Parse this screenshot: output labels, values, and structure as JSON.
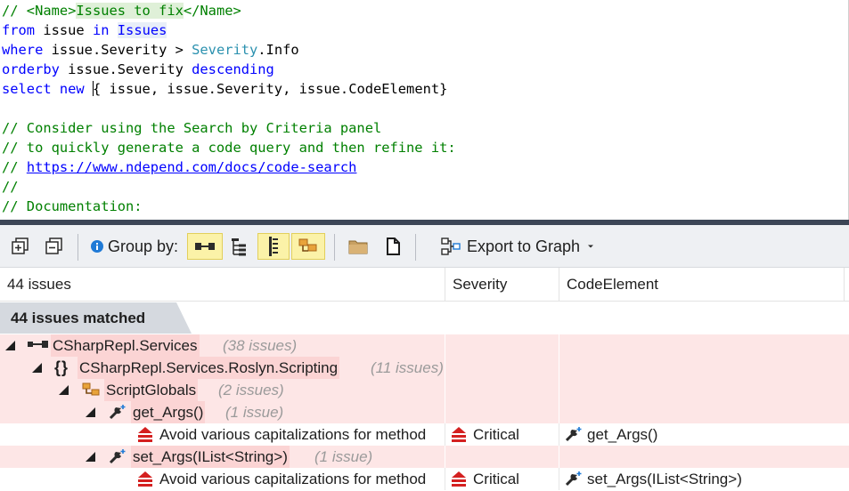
{
  "editor": {
    "line1_prefix": "// <Name>",
    "line1_highlight": "Issues to fix",
    "line1_suffix": "</Name>",
    "line2_kw1": "from",
    "line2_var": " issue ",
    "line2_kw2": "in",
    "line2_sp": " ",
    "line2_src": "Issues",
    "line3_kw": "where",
    "line3_mid": " issue.Severity > ",
    "line3_type": "Severity",
    "line3_end": ".Info",
    "line4_kw": "orderby",
    "line4_mid": " issue.Severity ",
    "line4_kw2": "descending",
    "line5_kw": "select new",
    "line5_space": " ",
    "line5_rest": "{ issue, issue.Severity, issue.CodeElement}",
    "line6": "// Consider using the Search by Criteria panel",
    "line7": "// to quickly generate a code query and then refine it:",
    "line8_prefix": "// ",
    "line8_link": "https://www.ndepend.com/docs/code-search",
    "line9": "//",
    "line10": "// Documentation:"
  },
  "toolbar": {
    "group_by_label": "Group by:",
    "export_label": "Export to Graph"
  },
  "grid": {
    "col1": "44 issues",
    "col2": "Severity",
    "col3": "CodeElement",
    "banner": "44 issues matched"
  },
  "tree": {
    "assembly": "CSharpRepl.Services",
    "assembly_count": "(38 issues)",
    "namespace": "CSharpRepl.Services.Roslyn.Scripting",
    "namespace_count": "(11 issues)",
    "type": "ScriptGlobals",
    "type_count": "(2 issues)",
    "method1": "get_Args()",
    "method1_count": "(1 issue)",
    "issue1": "Avoid various capitalizations for method",
    "issue1_severity": "Critical",
    "issue1_element": "get_Args()",
    "method2": "set_Args(IList<String>)",
    "method2_count": "(1 issue)",
    "issue2": "Avoid various capitalizations for method",
    "issue2_severity": "Critical",
    "issue2_element": "set_Args(IList<String>)"
  },
  "colors": {
    "keyword": "#0000ff",
    "comment": "#008000",
    "type": "#2b91af",
    "issue_row": "#fde6e6",
    "critical": "#d42020"
  },
  "icons": {
    "expand_all": "expand-all-icon",
    "collapse_all": "collapse-all-icon",
    "info": "info-icon",
    "group_assembly": "assembly-icon",
    "group_hierarchy": "hierarchy-icon",
    "group_list": "list-icon",
    "group_type": "type-icon",
    "folder": "folder-icon",
    "document": "document-icon",
    "graph": "graph-icon",
    "method": "method-icon",
    "critical": "critical-severity-icon"
  }
}
